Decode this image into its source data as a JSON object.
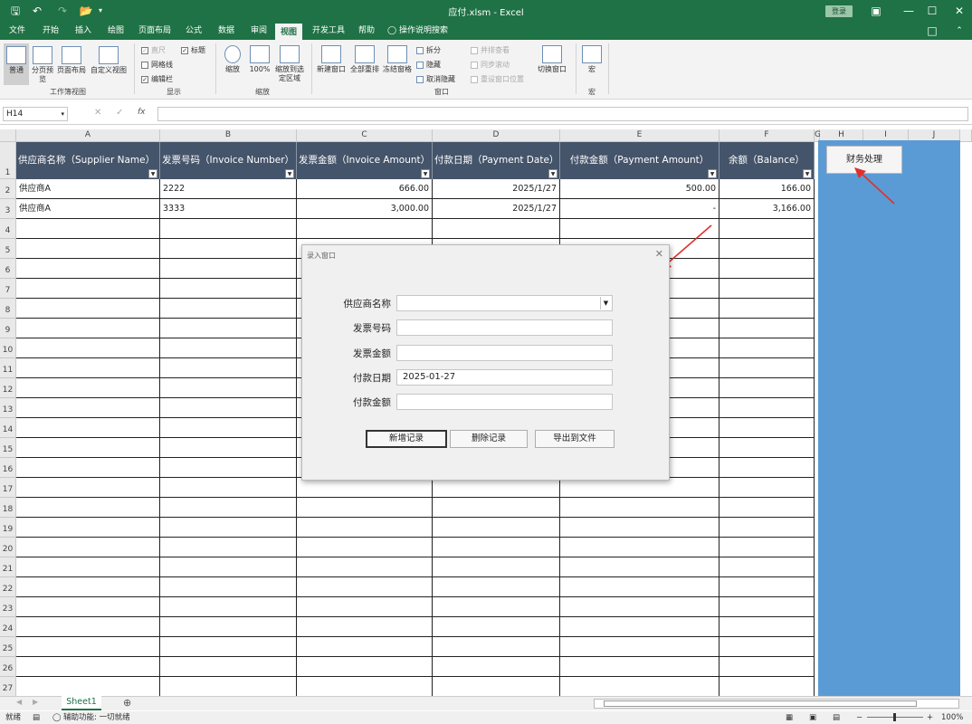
{
  "window": {
    "title": "应付.xlsm  -  Excel",
    "login_label": "登录"
  },
  "menu": {
    "items": [
      "文件",
      "开始",
      "插入",
      "绘图",
      "页面布局",
      "公式",
      "数据",
      "审阅",
      "视图",
      "开发工具",
      "帮助"
    ],
    "active": "视图",
    "search_label": "操作说明搜索"
  },
  "ribbon": {
    "workbook_views": {
      "normal": "普通",
      "page_break": "分页预览",
      "page_layout": "页面布局",
      "custom_view": "自定义视图",
      "group": "工作簿视图"
    },
    "show": {
      "ruler": "直尺",
      "gridlines": "网格线",
      "formula_bar": "编辑栏",
      "headings": "标题",
      "group": "显示"
    },
    "zoom": {
      "zoom": "缩放",
      "hundred": "100%",
      "zoom_selection": "缩放到选定区域",
      "group": "缩放"
    },
    "window": {
      "new_window": "新建窗口",
      "arrange_all": "全部重排",
      "freeze_panes": "冻结窗格",
      "split": "拆分",
      "hide": "隐藏",
      "unhide": "取消隐藏",
      "view_side": "并排查看",
      "sync_scroll": "同步滚动",
      "reset_pos": "重设窗口位置",
      "switch_windows": "切换窗口",
      "group": "窗口"
    },
    "macros": {
      "macros": "宏",
      "group": "宏"
    }
  },
  "formula_bar": {
    "name_box": "H14",
    "fx": "fx",
    "value": ""
  },
  "columns": [
    "A",
    "B",
    "C",
    "D",
    "E",
    "F",
    "G",
    "H",
    "I",
    "J"
  ],
  "table": {
    "headers": [
      "供应商名称（Supplier Name）",
      "发票号码（Invoice Number）",
      "发票金额（Invoice Amount）",
      "付款日期（Payment Date）",
      "付款金额（Payment Amount）",
      "余额（Balance）"
    ],
    "rows": [
      [
        "供应商A",
        "2222",
        "666.00",
        "2025/1/27",
        "500.00",
        "166.00"
      ],
      [
        "供应商A",
        "3333",
        "3,000.00",
        "2025/1/27",
        "-",
        "3,166.00"
      ]
    ]
  },
  "row_numbers": [
    "1",
    "2",
    "3",
    "4",
    "5",
    "6",
    "7",
    "8",
    "9",
    "10",
    "11",
    "12",
    "13",
    "14",
    "15",
    "16",
    "17",
    "18",
    "19",
    "20",
    "21",
    "22",
    "23",
    "24",
    "25",
    "26",
    "27"
  ],
  "finance_button": "财务处理",
  "dialog": {
    "title": "录入窗口",
    "fields": [
      {
        "label": "供应商名称",
        "value": "",
        "type": "dropdown"
      },
      {
        "label": "发票号码",
        "value": ""
      },
      {
        "label": "发票金额",
        "value": ""
      },
      {
        "label": "付款日期",
        "value": "2025-01-27"
      },
      {
        "label": "付款金额",
        "value": ""
      }
    ],
    "buttons": [
      "新增记录",
      "删除记录",
      "导出到文件"
    ]
  },
  "sheet_tab": "Sheet1",
  "status": {
    "ready": "就绪",
    "accessibility": "辅助功能: 一切就绪",
    "zoom": "100%"
  },
  "colors": {
    "excel_green": "#1f7245",
    "header_fill": "#44546a",
    "pane_blue": "#5b9bd5",
    "arrow_red": "#e0302a"
  }
}
